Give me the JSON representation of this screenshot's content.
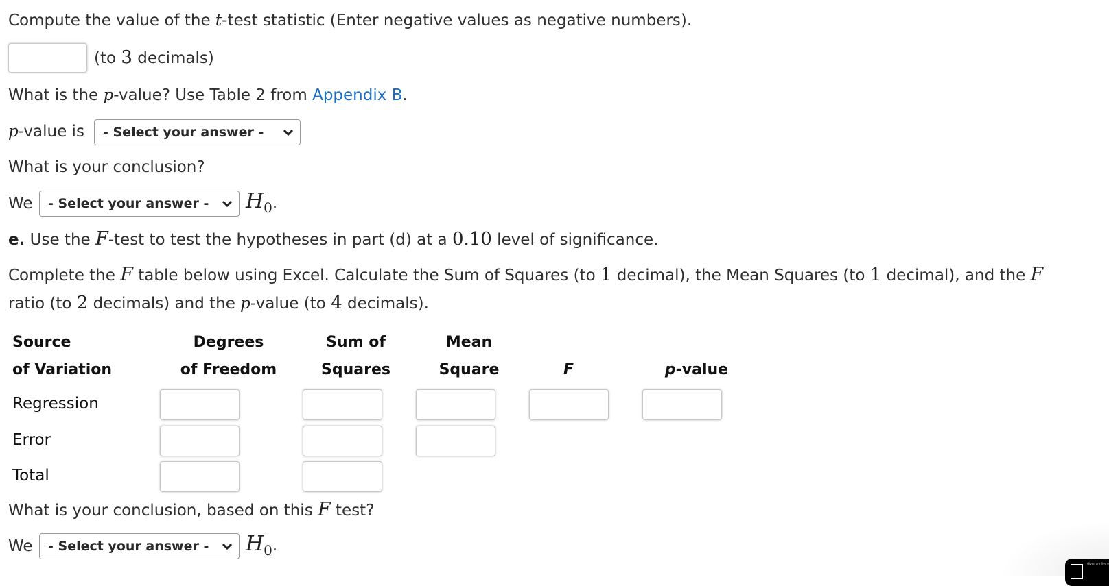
{
  "q_tstat": {
    "prompt_pre": "Compute the value of the ",
    "var": "t",
    "prompt_post": "-test statistic (Enter negative values as negative numbers).",
    "input_value": "",
    "hint_pre": "(to ",
    "hint_num": "3",
    "hint_post": " decimals)"
  },
  "q_pvalue": {
    "prompt_pre": "What is the ",
    "var": "p",
    "prompt_mid": "-value? Use Table 2 from ",
    "link": "Appendix B",
    "prompt_post": ".",
    "label_var": "p",
    "label_post": "-value is",
    "select_value": "- Select your answer -"
  },
  "q_conclusion1": {
    "prompt": "What is your conclusion?",
    "we": "We",
    "select_value": "- Select your answer -",
    "h": "H",
    "h_sub": "0",
    "period": "."
  },
  "part_e": {
    "label": "e.",
    "text_pre": " Use the ",
    "var": "F",
    "text_mid": "-test to test the hypotheses in part (d) at a ",
    "alpha": "0.10",
    "text_post": " level of significance."
  },
  "instructions": {
    "p1": "Complete the ",
    "var1": "F",
    "p2": " table below using Excel. Calculate the Sum of Squares (to ",
    "n1": "1",
    "p3": " decimal), the Mean Squares (to ",
    "n2": "1",
    "p4": " decimal), and the ",
    "var2": "F",
    "p5": "ratio (to ",
    "n3": "2",
    "p6": " decimals) and the ",
    "var3": "p",
    "p7": "-value (to ",
    "n4": "4",
    "p8": " decimals)."
  },
  "anova_table": {
    "headers": {
      "source_1": "Source",
      "source_2": "of Variation",
      "df_1": "Degrees",
      "df_2": "of Freedom",
      "ss_1": "Sum of",
      "ss_2": "Squares",
      "ms_1": "Mean",
      "ms_2": "Square",
      "f": "F",
      "p_var": "p",
      "p_post": "-value"
    },
    "rows": [
      {
        "label": "Regression",
        "df": "",
        "ss": "",
        "ms": "",
        "f": "",
        "p": ""
      },
      {
        "label": "Error",
        "df": "",
        "ss": "",
        "ms": ""
      },
      {
        "label": "Total",
        "df": "",
        "ss": ""
      }
    ]
  },
  "q_conclusion2": {
    "prompt_pre": "What is your conclusion, based on this ",
    "var": "F",
    "prompt_post": " test?",
    "we": "We",
    "select_value": "- Select your answer -",
    "h": "H",
    "h_sub": "0",
    "period": "."
  },
  "widget": {
    "text": "Given are five obse"
  }
}
